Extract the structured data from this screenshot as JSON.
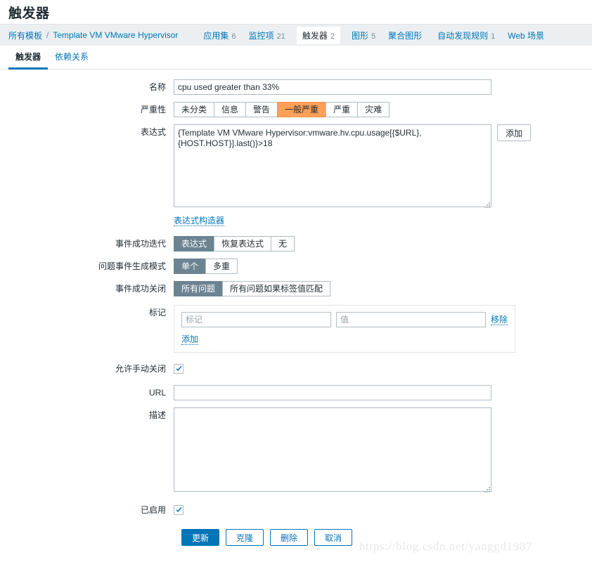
{
  "page": {
    "title": "触发器",
    "watermark": "https://blog.csdn.net/yanggd1987"
  },
  "breadcrumb": {
    "root_label": "所有模板",
    "separator": "/",
    "template_label": "Template VM VMware Hypervisor",
    "items": [
      {
        "label": "应用集",
        "count": "6",
        "selected": false
      },
      {
        "label": "监控项",
        "count": "21",
        "selected": false
      },
      {
        "label": "触发器",
        "count": "2",
        "selected": true
      },
      {
        "label": "图形",
        "count": "5",
        "selected": false
      },
      {
        "label": "聚合图形",
        "count": "",
        "selected": false
      },
      {
        "label": "自动发现规则",
        "count": "1",
        "selected": false
      },
      {
        "label": "Web 场景",
        "count": "",
        "selected": false
      }
    ]
  },
  "tabs": [
    {
      "label": "触发器",
      "active": true
    },
    {
      "label": "依赖关系",
      "active": false
    }
  ],
  "form": {
    "name": {
      "label": "名称",
      "value": "cpu used greater than 33%"
    },
    "severity": {
      "label": "严重性",
      "options": [
        "未分类",
        "信息",
        "警告",
        "一般严重",
        "严重",
        "灾难"
      ],
      "selected": "一般严重",
      "selected_color": "#ffa059"
    },
    "expression": {
      "label": "表达式",
      "value": "{Template VM VMware Hypervisor:vmware.hv.cpu.usage[{$URL},{HOST.HOST}].last()}>18",
      "add_button": "添加",
      "constructor_link": "表达式构造器"
    },
    "ok_event_generation": {
      "label": "事件成功迭代",
      "options": [
        "表达式",
        "恢复表达式",
        "无"
      ],
      "selected": "表达式"
    },
    "problem_event_generation_mode": {
      "label": "问题事件生成模式",
      "options": [
        "单个",
        "多重"
      ],
      "selected": "单个"
    },
    "ok_event_closes": {
      "label": "事件成功关闭",
      "options": [
        "所有问题",
        "所有问题如果标签值匹配"
      ],
      "selected": "所有问题"
    },
    "tags": {
      "label": "标记",
      "rows": [
        {
          "name_placeholder": "标记",
          "name_value": "",
          "value_placeholder": "值",
          "value_value": "",
          "remove_label": "移除"
        }
      ],
      "add_label": "添加"
    },
    "allow_manual_close": {
      "label": "允许手动关闭",
      "checked": true
    },
    "url": {
      "label": "URL",
      "value": ""
    },
    "description": {
      "label": "描述",
      "value": ""
    },
    "enabled": {
      "label": "已启用",
      "checked": true
    }
  },
  "actions": {
    "update": "更新",
    "clone": "克隆",
    "delete": "删除",
    "cancel": "取消"
  },
  "colors": {
    "link": "#0275b8",
    "primary": "#0275b8",
    "selected_segment": "#6c8392",
    "severity_average": "#ffa059",
    "bar_bg": "#ebeff2"
  }
}
